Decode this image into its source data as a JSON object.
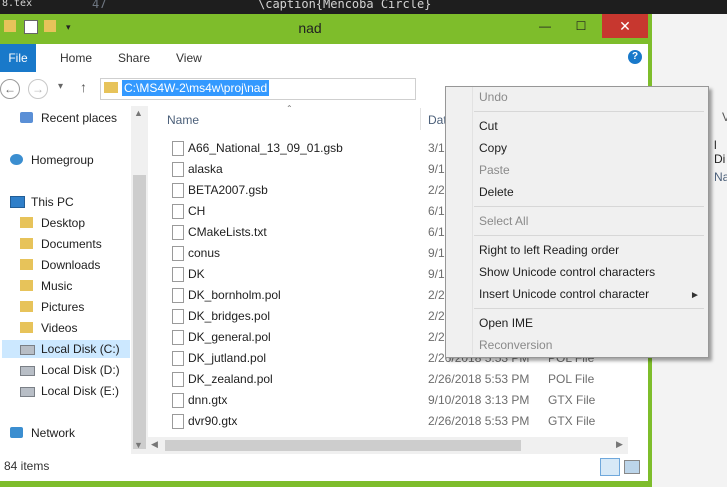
{
  "editor": {
    "line_number": "47",
    "code": "\\caption{Mencoba Circle}",
    "left_tab": "8.tex"
  },
  "window": {
    "title": "nad",
    "close_glyph": "✕",
    "minimize_glyph": "—",
    "maximize_glyph": "☐"
  },
  "ribbon": {
    "tabs": [
      "File",
      "Home",
      "Share",
      "View"
    ],
    "help_glyph": "?"
  },
  "address": {
    "path": "C:\\MS4W-2\\ms4w\\proj\\nad",
    "back_glyph": "←",
    "forward_glyph": "→",
    "recent_glyph": "▾",
    "up_glyph": "↑"
  },
  "nav_pane": {
    "items": [
      {
        "label": "Recent places",
        "icon": "recent-places-icon"
      },
      {
        "label": "Homegroup",
        "icon": "homegroup-icon"
      },
      {
        "label": "This PC",
        "icon": "computer-icon"
      },
      {
        "label": "Desktop",
        "icon": "folder-icon"
      },
      {
        "label": "Documents",
        "icon": "folder-icon"
      },
      {
        "label": "Downloads",
        "icon": "folder-icon"
      },
      {
        "label": "Music",
        "icon": "folder-icon"
      },
      {
        "label": "Pictures",
        "icon": "folder-icon"
      },
      {
        "label": "Videos",
        "icon": "folder-icon"
      },
      {
        "label": "Local Disk (C:)",
        "icon": "drive-icon"
      },
      {
        "label": "Local Disk (D:)",
        "icon": "drive-icon"
      },
      {
        "label": "Local Disk (E:)",
        "icon": "drive-icon"
      },
      {
        "label": "Network",
        "icon": "network-icon"
      }
    ]
  },
  "columns": {
    "name": "Name",
    "date": "Dat"
  },
  "files": [
    {
      "name": "A66_National_13_09_01.gsb",
      "date": "3/1",
      "type": ""
    },
    {
      "name": "alaska",
      "date": "9/1",
      "type": ""
    },
    {
      "name": "BETA2007.gsb",
      "date": "2/2",
      "type": ""
    },
    {
      "name": "CH",
      "date": "6/1",
      "type": ""
    },
    {
      "name": "CMakeLists.txt",
      "date": "6/1",
      "type": ""
    },
    {
      "name": "conus",
      "date": "9/1",
      "type": ""
    },
    {
      "name": "DK",
      "date": "9/1",
      "type": ""
    },
    {
      "name": "DK_bornholm.pol",
      "date": "2/2",
      "type": ""
    },
    {
      "name": "DK_bridges.pol",
      "date": "2/2",
      "type": ""
    },
    {
      "name": "DK_general.pol",
      "date": "2/2",
      "type": ""
    },
    {
      "name": "DK_jutland.pol",
      "date": "2/26/2018 5:53 PM",
      "type": "POL File"
    },
    {
      "name": "DK_zealand.pol",
      "date": "2/26/2018 5:53 PM",
      "type": "POL File"
    },
    {
      "name": "dnn.gtx",
      "date": "9/10/2018 3:13 PM",
      "type": "GTX File"
    },
    {
      "name": "dvr90.gtx",
      "date": "2/26/2018 5:53 PM",
      "type": "GTX File"
    }
  ],
  "status": {
    "item_count": "84 items"
  },
  "context_menu": {
    "items": [
      {
        "label": "Undo",
        "enabled": false
      },
      {
        "label": "Cut",
        "enabled": true
      },
      {
        "label": "Copy",
        "enabled": true
      },
      {
        "label": "Paste",
        "enabled": false
      },
      {
        "label": "Delete",
        "enabled": true
      },
      {
        "label": "Select All",
        "enabled": false
      },
      {
        "label": "Right to left Reading order",
        "enabled": true
      },
      {
        "label": "Show Unicode control characters",
        "enabled": true
      },
      {
        "label": "Insert Unicode control character",
        "enabled": true
      },
      {
        "label": "Open IME",
        "enabled": true
      },
      {
        "label": "Reconversion",
        "enabled": false
      }
    ],
    "submenu_glyph": "►"
  },
  "right_window": {
    "tab_fragment": "Vi",
    "label_fragment": "l Di",
    "col_fragment": "Na"
  },
  "colors": {
    "titlebar": "#7ebd2b",
    "file_tab": "#1979ca",
    "selection": "#3399ff",
    "close": "#c7372f"
  }
}
